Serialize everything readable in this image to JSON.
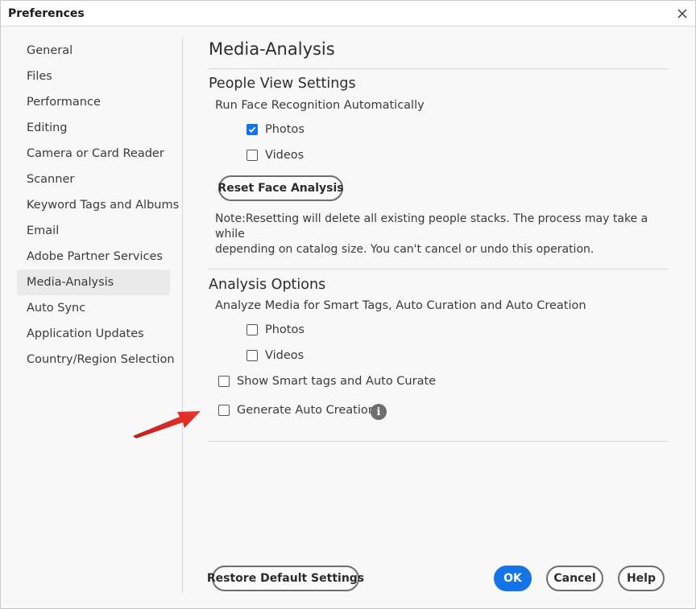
{
  "window": {
    "title": "Preferences"
  },
  "sidebar": {
    "items": [
      {
        "label": "General"
      },
      {
        "label": "Files"
      },
      {
        "label": "Performance"
      },
      {
        "label": "Editing"
      },
      {
        "label": "Camera or Card Reader"
      },
      {
        "label": "Scanner"
      },
      {
        "label": "Keyword Tags and Albums"
      },
      {
        "label": "Email"
      },
      {
        "label": "Adobe Partner Services"
      },
      {
        "label": "Media-Analysis"
      },
      {
        "label": "Auto Sync"
      },
      {
        "label": "Application Updates"
      },
      {
        "label": "Country/Region Selection"
      }
    ],
    "selected": "Media-Analysis"
  },
  "main": {
    "page_title": "Media-Analysis",
    "people_view": {
      "title": "People View Settings",
      "run_label": "Run Face Recognition Automatically",
      "photos": {
        "label": "Photos",
        "checked": true
      },
      "videos": {
        "label": "Videos",
        "checked": false
      },
      "reset_button": "Reset Face Analysis",
      "note_line1": "Note:Resetting will delete all existing people stacks. The process may take a while",
      "note_line2": "depending on catalog size. You can't cancel or undo this operation."
    },
    "analysis": {
      "title": "Analysis Options",
      "analyze_label": "Analyze Media for Smart Tags, Auto Curation and Auto Creation",
      "photos": {
        "label": "Photos",
        "checked": false
      },
      "videos": {
        "label": "Videos",
        "checked": false
      },
      "smart_tags": {
        "label": "Show Smart tags and Auto Curate",
        "checked": false
      },
      "auto_creations": {
        "label": "Generate Auto Creations",
        "checked": false
      }
    }
  },
  "footer": {
    "restore": "Restore Default Settings",
    "ok": "OK",
    "cancel": "Cancel",
    "help": "Help"
  },
  "colors": {
    "accent": "#1473e6",
    "arrow": "#e0201a"
  },
  "icons": [
    "close-icon",
    "checkmark-icon",
    "info-icon",
    "red-arrow-icon"
  ]
}
